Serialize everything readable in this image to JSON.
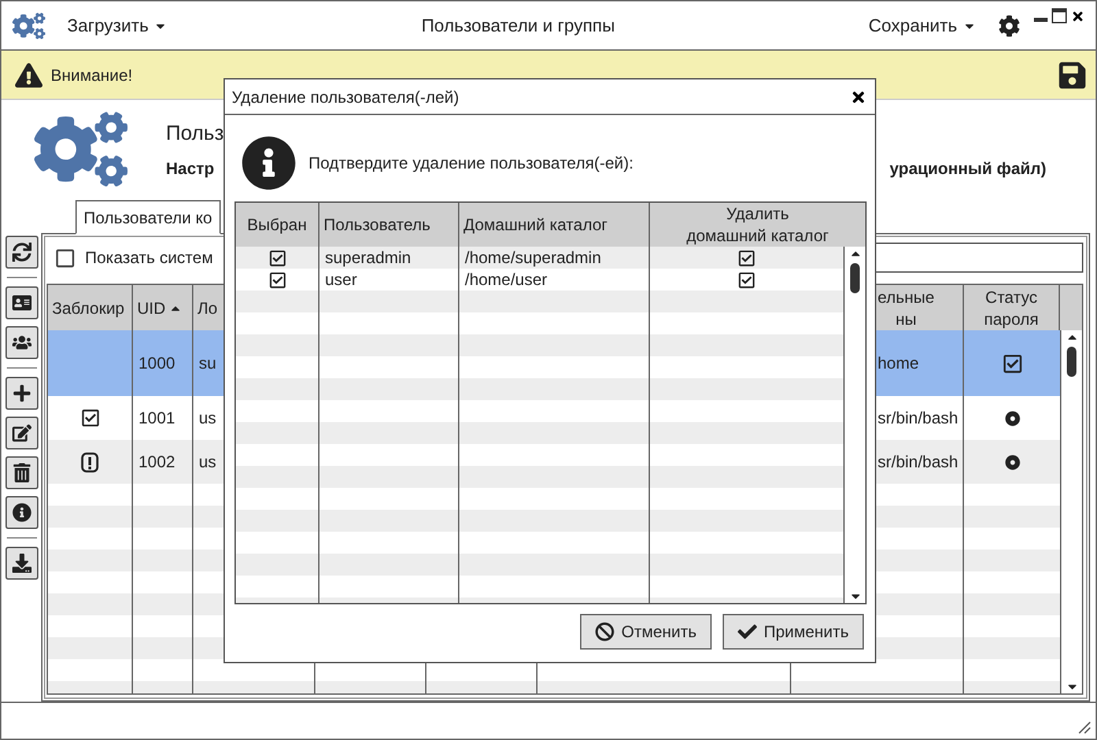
{
  "window": {
    "title": "Пользователи и группы",
    "load_menu": {
      "label": "Загрузить"
    },
    "save_menu": {
      "label": "Сохранить"
    }
  },
  "warning": {
    "text": "Внимание!"
  },
  "header": {
    "title": "Польз",
    "subtitle": "Настр",
    "subtitle_tail": "урационный файл)"
  },
  "tabs": [
    {
      "label": "Пользователи ко",
      "selected": true
    }
  ],
  "show_system": {
    "label": "Показать систем",
    "checked": false
  },
  "users_table": {
    "columns": [
      {
        "label": "Заблокир",
        "sorted_ascending": false
      },
      {
        "label": "UID",
        "sorted_ascending": true
      },
      {
        "label": "Ло"
      },
      {},
      {},
      {},
      {
        "label": "ельные\nны",
        "sorted_ascending": false
      },
      {
        "label": "Статус пароля",
        "sorted_ascending": false
      }
    ],
    "rows": [
      {
        "selected": true,
        "locked": false,
        "alert": false,
        "cells": [
          null,
          "1000",
          "su",
          null,
          null,
          null,
          "home",
          null
        ],
        "password_set": true
      },
      {
        "selected": false,
        "locked": true,
        "alert": false,
        "cells": [
          null,
          "1001",
          "us",
          null,
          null,
          null,
          "sr/bin/bash",
          null
        ],
        "password_set": false
      },
      {
        "selected": false,
        "locked": false,
        "alert": true,
        "cells": [
          null,
          "1002",
          "us",
          null,
          null,
          null,
          "sr/bin/bash",
          null
        ],
        "password_set": false
      }
    ]
  },
  "dialog": {
    "title": "Удаление пользователя(-лей)",
    "message": "Подтвердите удаление пользователя(-ей):",
    "columns": [
      "Выбран",
      "Пользователь",
      "Домашний каталог",
      "Удалить\nдомашний каталог"
    ],
    "rows": [
      {
        "selected": true,
        "user": "superadmin",
        "home": "/home/superadmin",
        "delete_home": true
      },
      {
        "selected": true,
        "user": "user",
        "home": "/home/user",
        "delete_home": true
      }
    ],
    "buttons": [
      {
        "label": "Отменить",
        "kind": "cancel"
      },
      {
        "label": "Применить",
        "kind": "apply"
      }
    ]
  }
}
